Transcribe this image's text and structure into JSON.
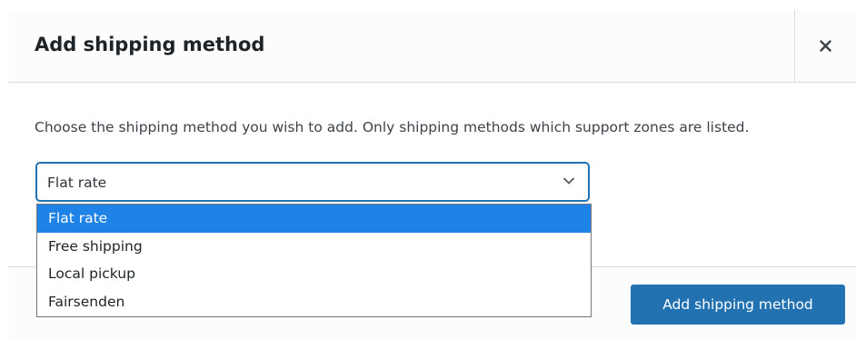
{
  "dialog": {
    "title": "Add shipping method",
    "close_icon": "close-icon",
    "description": "Choose the shipping method you wish to add. Only shipping methods which support zones are listed."
  },
  "select": {
    "value": "Flat rate",
    "icon": "chevron-down-icon",
    "options": [
      {
        "label": "Flat rate",
        "selected": true
      },
      {
        "label": "Free shipping",
        "selected": false
      },
      {
        "label": "Local pickup",
        "selected": false
      },
      {
        "label": "Fairsenden",
        "selected": false
      }
    ]
  },
  "footer": {
    "submit_label": "Add shipping method"
  },
  "colors": {
    "accent": "#2271b1",
    "option_highlight": "#1e82e6",
    "text": "#1d2327",
    "border": "#dcdcde"
  }
}
